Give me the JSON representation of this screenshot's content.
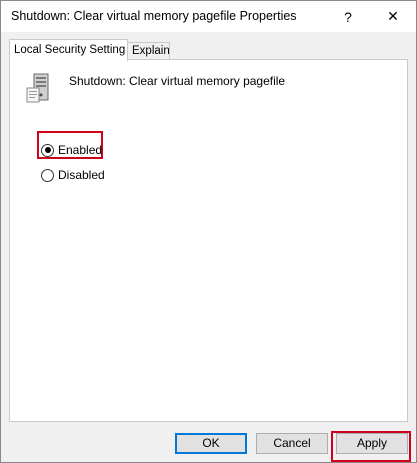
{
  "window": {
    "title": "Shutdown: Clear virtual memory pagefile Properties",
    "help_glyph": "?",
    "close_glyph": "✕"
  },
  "tabs": [
    {
      "label": "Local Security Setting",
      "active": true
    },
    {
      "label": "Explain",
      "active": false
    }
  ],
  "policy": {
    "icon": "policy-server-icon",
    "name": "Shutdown: Clear virtual memory pagefile"
  },
  "options": [
    {
      "label": "Enabled",
      "checked": true
    },
    {
      "label": "Disabled",
      "checked": false
    }
  ],
  "buttons": {
    "ok": "OK",
    "cancel": "Cancel",
    "apply": "Apply"
  },
  "highlight_color": "#d0021b"
}
